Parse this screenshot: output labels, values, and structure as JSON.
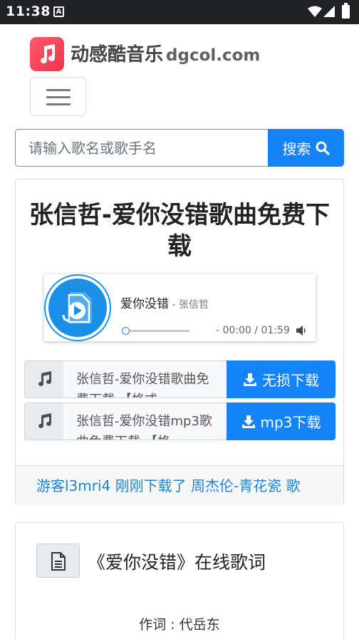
{
  "status_bar": {
    "time": "11:38",
    "notification_letter": "A"
  },
  "header": {
    "site_name": "动感酷音乐",
    "site_domain": "dgcol.com"
  },
  "search": {
    "placeholder": "请输入歌名或歌手名",
    "button_label": "搜索"
  },
  "song": {
    "title": "张信哲-爱你没错歌曲免费下载"
  },
  "player": {
    "track_title": "爱你没错",
    "track_artist": " - 张信哲",
    "time_display": "- 00:00 / 01:59"
  },
  "downloads": [
    {
      "description": "张信哲-爱你没错歌曲免费下载 【格式",
      "button_label": "无损下载"
    },
    {
      "description": "张信哲-爱你没错mp3歌曲免费下载 【格",
      "button_label": "mp3下载"
    }
  ],
  "recent_activity": "游客l3mri4 刚刚下载了 周杰伦-青花瓷 歌",
  "lyrics": {
    "title": "《爱你没错》在线歌词",
    "lyricist_line": "作词 : 代岳东"
  },
  "colors": {
    "primary": "#1383f7",
    "link": "#1a86d8",
    "logo": "#f0334b",
    "status_bar": "#212226"
  }
}
